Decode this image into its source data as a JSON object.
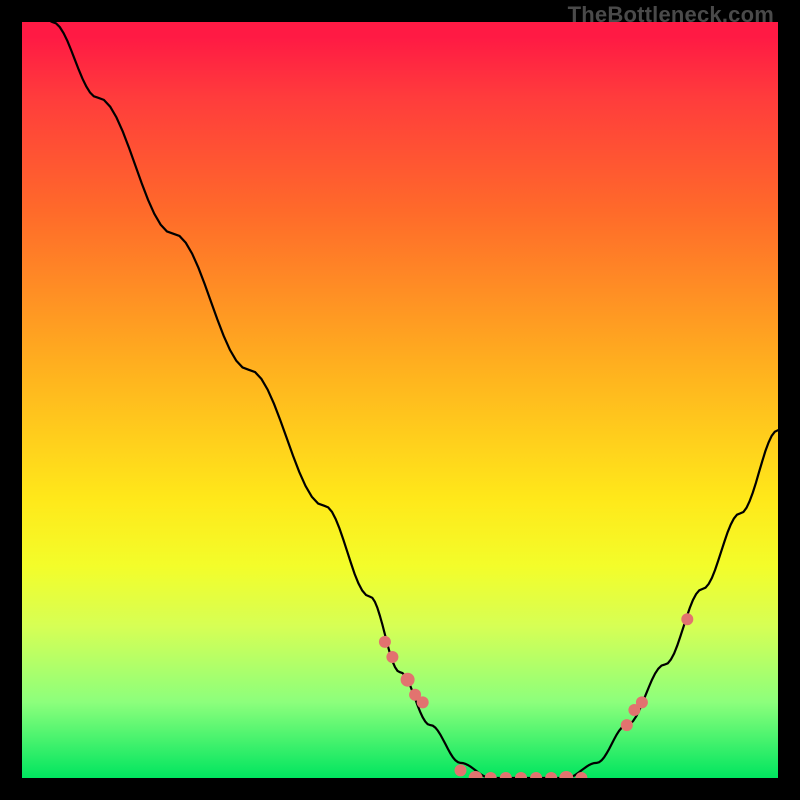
{
  "watermark": "TheBottleneck.com",
  "chart_data": {
    "type": "line",
    "title": "",
    "xlabel": "",
    "ylabel": "",
    "xlim": [
      0,
      100
    ],
    "ylim": [
      0,
      100
    ],
    "grid": false,
    "legend": false,
    "series": [
      {
        "name": "bottleneck-curve",
        "x": [
          0,
          4,
          10,
          20,
          30,
          40,
          46,
          50,
          54,
          58,
          62,
          66,
          70,
          72,
          76,
          80,
          85,
          90,
          95,
          100
        ],
        "y": [
          110,
          100,
          90,
          72,
          54,
          36,
          24,
          14,
          7,
          2,
          0,
          0,
          0,
          0,
          2,
          7,
          15,
          25,
          35,
          46
        ]
      }
    ],
    "points": {
      "name": "highlighted-points",
      "x": [
        48,
        49,
        51,
        52,
        53,
        58,
        60,
        62,
        64,
        66,
        68,
        70,
        72,
        74,
        80,
        81,
        82,
        88
      ],
      "y": [
        18,
        16,
        13,
        11,
        10,
        1,
        0,
        0,
        0,
        0,
        0,
        0,
        0,
        0,
        7,
        9,
        10,
        21
      ]
    },
    "gradient_stops": [
      {
        "pos": 0,
        "color": "#ff1a44"
      },
      {
        "pos": 25,
        "color": "#ff6a2a"
      },
      {
        "pos": 45,
        "color": "#ffae1f"
      },
      {
        "pos": 63,
        "color": "#ffe81a"
      },
      {
        "pos": 80,
        "color": "#d6ff55"
      },
      {
        "pos": 100,
        "color": "#00e55f"
      }
    ]
  }
}
